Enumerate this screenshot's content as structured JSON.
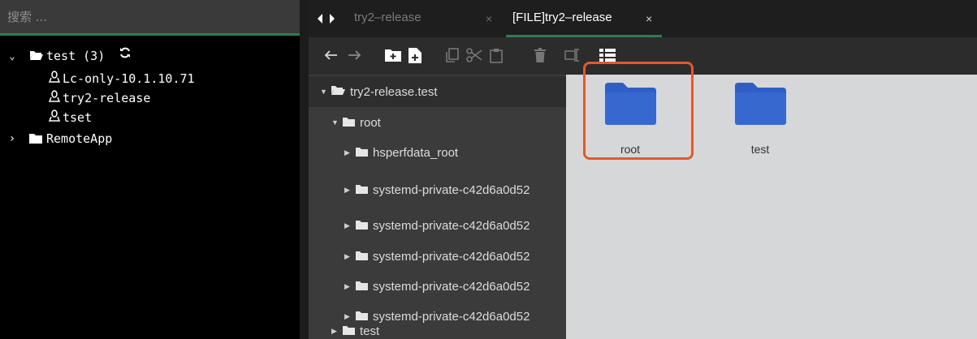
{
  "search": {
    "placeholder": "搜索 ..."
  },
  "sidebar": {
    "groups": [
      {
        "label": "test (3)",
        "expanded": true,
        "hosts": [
          "Lc-only-10.1.10.71",
          "try2-release",
          "tset"
        ]
      },
      {
        "label": "RemoteApp",
        "expanded": false
      }
    ]
  },
  "tabs": [
    {
      "label": "try2–release",
      "close": "×",
      "active": false
    },
    {
      "label": "[FILE]try2–release",
      "close": "×",
      "active": true
    }
  ],
  "filetree": {
    "root_label": "try2-release.test",
    "children": [
      {
        "label": "root",
        "expanded": true,
        "children": [
          "hsperfdata_root",
          "systemd-private-c42d6a0d52",
          "systemd-private-c42d6a0d52",
          "systemd-private-c42d6a0d52",
          "systemd-private-c42d6a0d52",
          "systemd-private-c42d6a0d52"
        ]
      },
      {
        "label": "test",
        "expanded": false
      }
    ]
  },
  "iconview": {
    "items": [
      "root",
      "test"
    ]
  },
  "colors": {
    "accent": "#2e7d4f",
    "folder": "#2f5fc4",
    "selection": "#e05a2b"
  }
}
